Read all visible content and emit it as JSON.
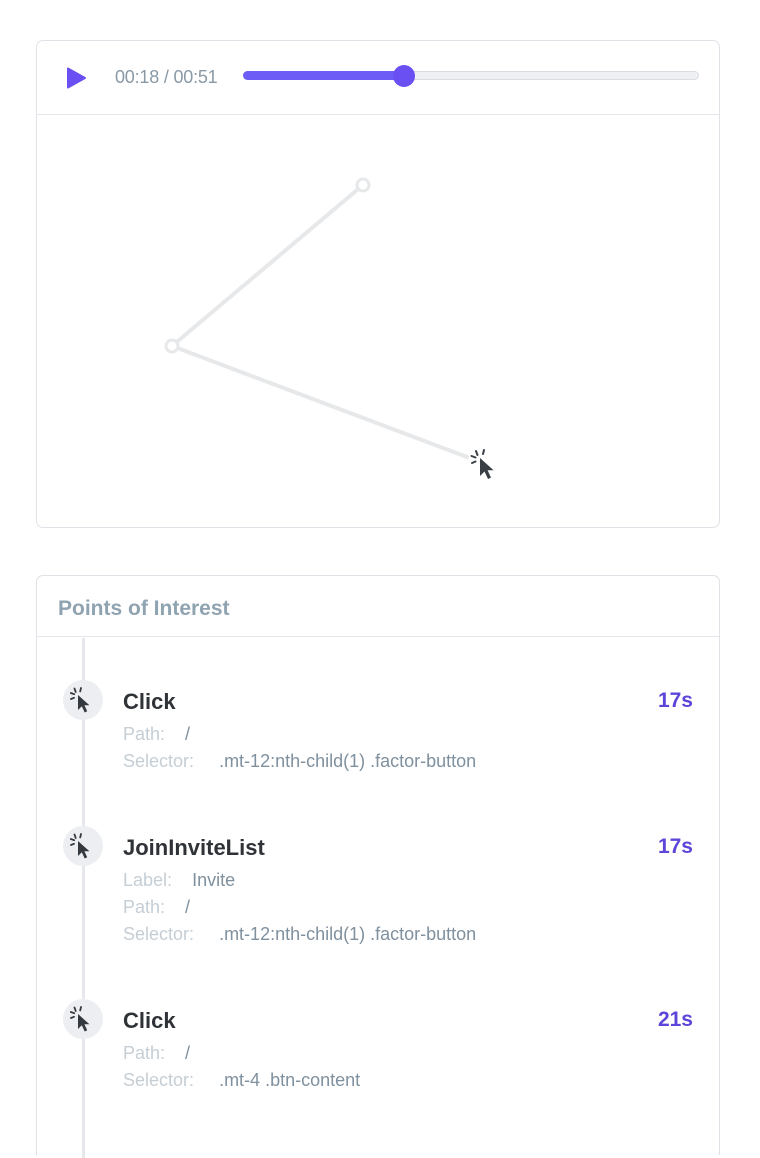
{
  "player": {
    "time_display": "00:18 / 00:51",
    "progress_fraction": 0.353,
    "accent_color": "#6a4ff3",
    "play_icon": "play-icon",
    "cursor_icon": "cursor-click-icon"
  },
  "poi": {
    "title": "Points of Interest",
    "events": [
      {
        "name": "Click",
        "time": "17s",
        "icon": "cursor-click-icon",
        "rows": [
          {
            "key": "Path:",
            "value": "/"
          },
          {
            "key": "Selector:",
            "value": ".mt-12:nth-child(1) .factor-button"
          }
        ]
      },
      {
        "name": "JoinInviteList",
        "time": "17s",
        "icon": "cursor-click-icon",
        "rows": [
          {
            "key": "Label:",
            "value": "Invite"
          },
          {
            "key": "Path:",
            "value": "/"
          },
          {
            "key": "Selector:",
            "value": ".mt-12:nth-child(1) .factor-button"
          }
        ]
      },
      {
        "name": "Click",
        "time": "21s",
        "icon": "cursor-click-icon",
        "rows": [
          {
            "key": "Path:",
            "value": "/"
          },
          {
            "key": "Selector:",
            "value": ".mt-4 .btn-content"
          }
        ]
      }
    ]
  }
}
